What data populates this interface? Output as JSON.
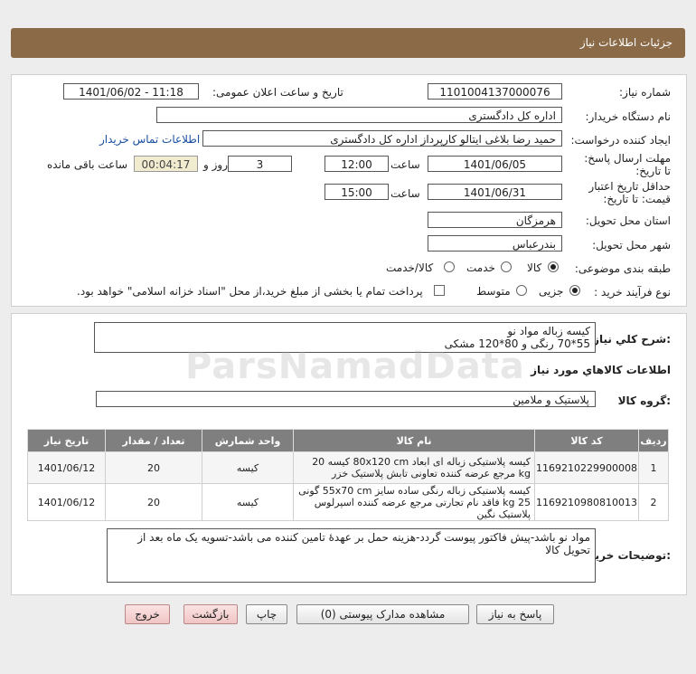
{
  "header": {
    "title": "جزئیات اطلاعات نیاز"
  },
  "form": {
    "need_number_label": "شماره نیاز:",
    "need_number": "1101004137000076",
    "announce_label": "تاریخ و ساعت اعلان عمومی:",
    "announce_value": "1401/06/02 - 11:18",
    "buyer_org_label": "نام دستگاه خریدار:",
    "buyer_org": "اداره کل دادگستری",
    "creator_label": "ایجاد کننده درخواست:",
    "creator": "حمید رضا  بلاغی ایتالو کارپرداز اداره کل دادگستری",
    "contact_link": "اطلاعات تماس خریدار",
    "deadline_label": "مهلت ارسال پاسخ: تا تاریخ:",
    "deadline_date": "1401/06/05",
    "time_label": "ساعت",
    "deadline_time": "12:00",
    "days_value": "3",
    "days_label": "روز و",
    "remaining_time": "00:04:17",
    "remaining_label": "ساعت باقی مانده",
    "validity_label": "حداقل تاریخ اعتبار قیمت: تا تاریخ:",
    "validity_date": "1401/06/31",
    "validity_time": "15:00",
    "province_label": "استان محل تحویل:",
    "province": "هرمزگان",
    "city_label": "شهر محل تحویل:",
    "city": "بندرعباس",
    "category_label": "طبقه بندی موضوعی:",
    "category_options": [
      "کالا",
      "خدمت",
      "کالا/خدمت"
    ],
    "process_label": "نوع فرآیند خرید :",
    "process_options": [
      "جزیی",
      "متوسط"
    ],
    "payment_note": "پرداخت تمام یا بخشی از مبلغ خرید،از محل \"اسناد خزانه اسلامی\" خواهد بود."
  },
  "description": {
    "label": "شرح کلي نياز:",
    "text": "کیسه زباله مواد نو\n55*70 رنگی و 80*120 مشکی"
  },
  "goods_info_title": "اطلاعات کالاهاي مورد نياز",
  "goods_group": {
    "label": "گروه کالا:",
    "value": "پلاستیک و ملامین"
  },
  "table": {
    "headers": [
      "ردیف",
      "کد کالا",
      "نام کالا",
      "واحد شمارش",
      "تعداد / مقدار",
      "تاریخ نیاز"
    ],
    "rows": [
      {
        "row": "1",
        "code": "1169210229900008",
        "name": "کیسه پلاستیکی زباله ای ابعاد 80x120 cm کیسه 20 kg مرجع عرضه کننده تعاونی تابش پلاستیک خزر",
        "unit": "کیسه",
        "qty": "20",
        "date": "1401/06/12"
      },
      {
        "row": "2",
        "code": "1169210980810013",
        "name": "کیسه پلاستیکی زباله رنگی ساده سایز 55x70 cm گونی 25 kg فاقد نام تجارتی مرجع عرضه کننده اسپرلوس پلاستیک نگین",
        "unit": "کیسه",
        "qty": "20",
        "date": "1401/06/12"
      }
    ]
  },
  "buyer_notes": {
    "label": "توضیحات خریدار:",
    "text": "مواد نو باشد-پیش فاکتور پیوست گردد-هزینه حمل بر عهدۀ تامین کننده می باشد-تسویه یک ماه بعد از تحویل کالا"
  },
  "buttons": {
    "reply": "پاسخ به نیاز",
    "attachments": "مشاهده مدارک پیوستی (0)",
    "print": "چاپ",
    "back": "بازگشت",
    "exit": "خروج"
  },
  "watermark": {
    "brand": "ParsNamadData"
  },
  "colors": {
    "header_bg": "#8b6a48",
    "table_header_bg": "#7f7f7f",
    "exit_button_bg": "#f0c4c4"
  }
}
